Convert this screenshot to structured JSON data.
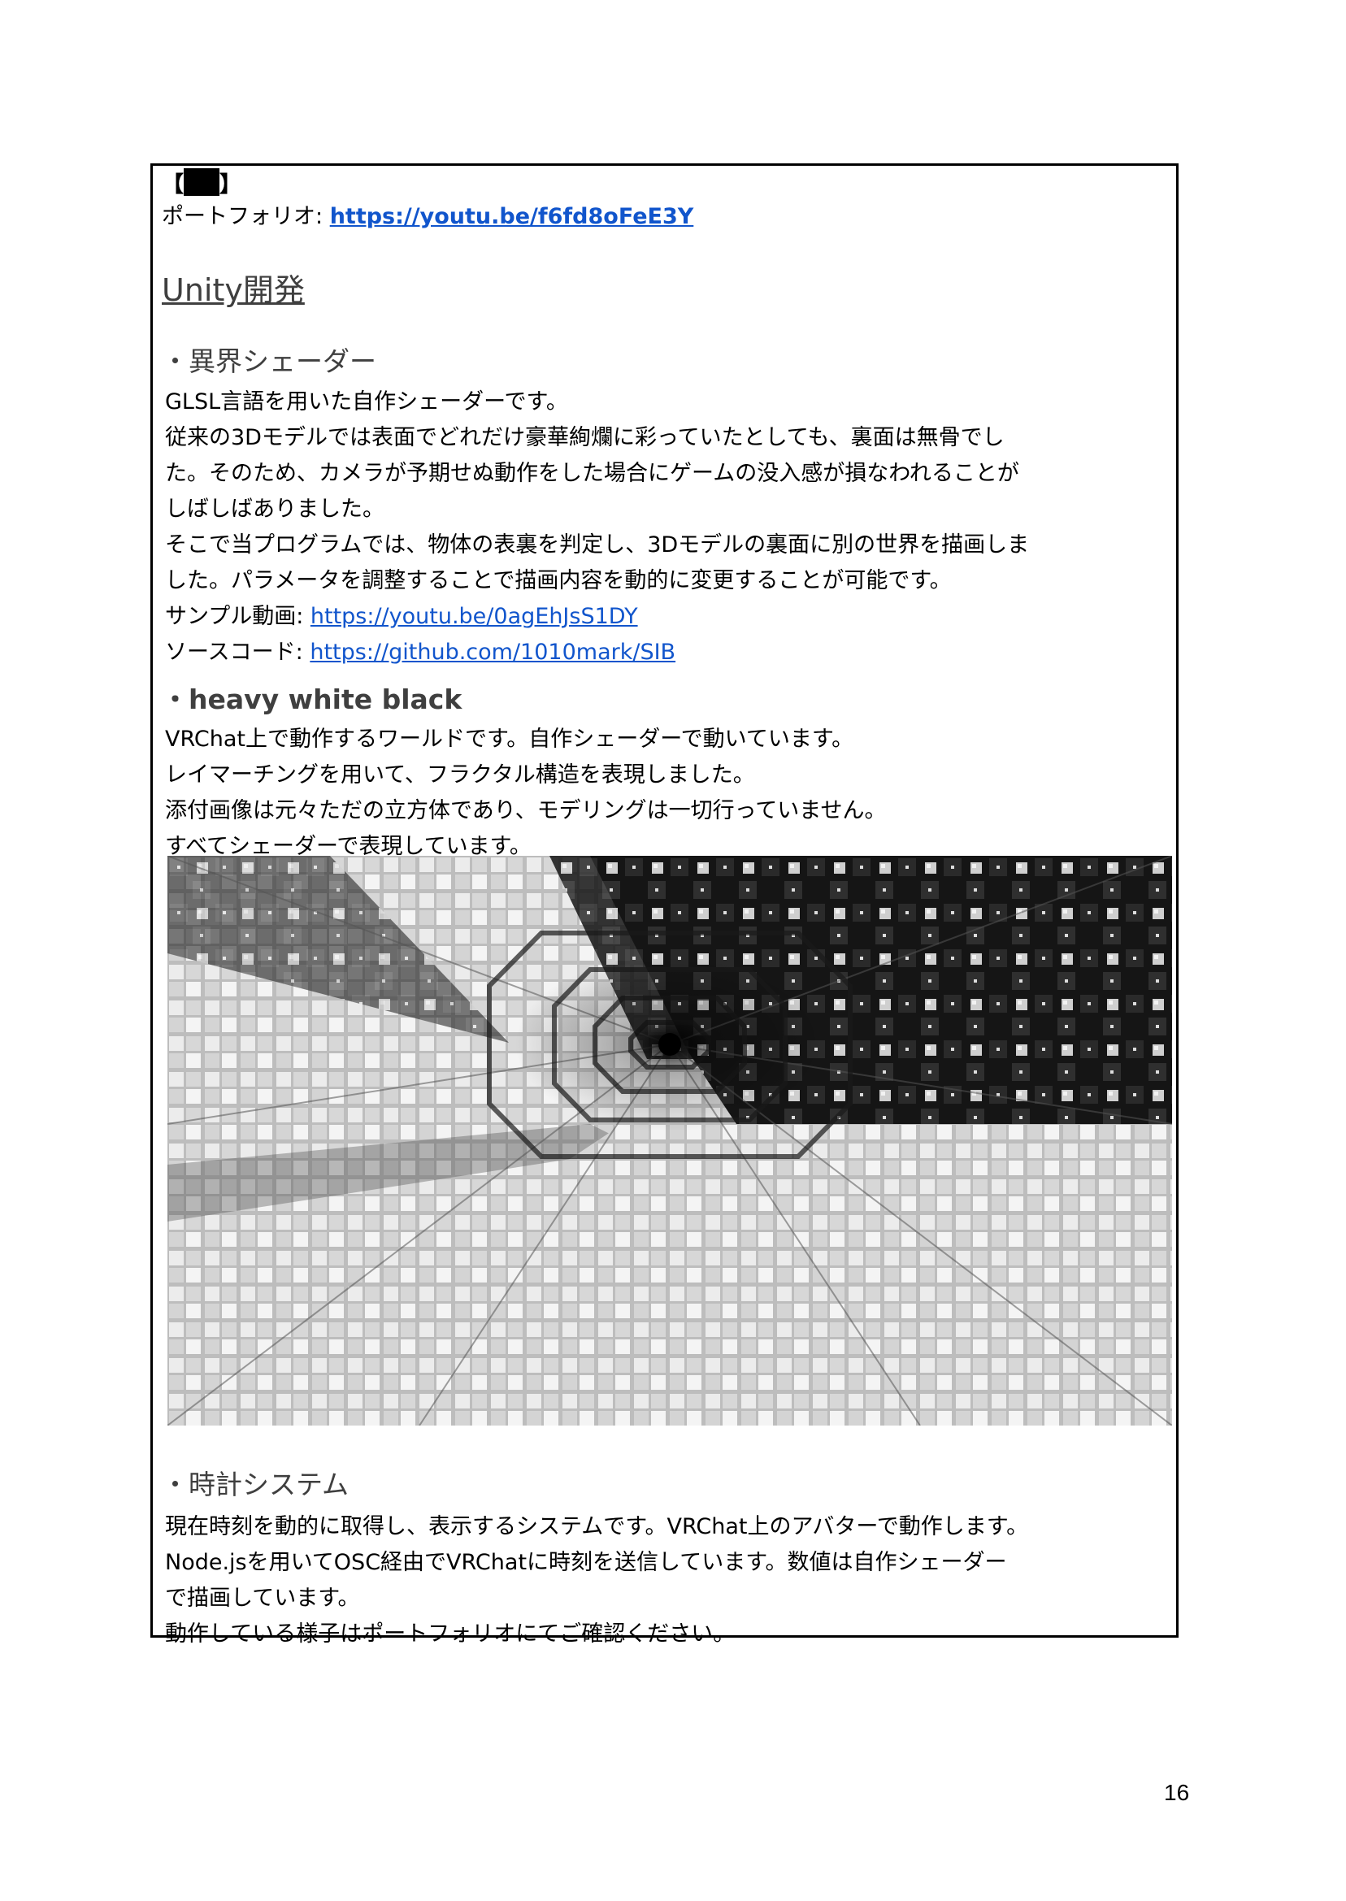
{
  "header": {
    "bracket_open": "【",
    "bracket_close": "】",
    "portfolio_label": "ポートフォリオ: ",
    "portfolio_url": "https://youtu.be/f6fd8oFeE3Y"
  },
  "section_title": "Unity開発",
  "shader": {
    "title": "・異界シェーダー",
    "lines": [
      "GLSL言語を用いた自作シェーダーです。",
      "従来の3Dモデルでは表面でどれだけ豪華絢爛に彩っていたとしても、裏面は無骨でし",
      "た。そのため、カメラが予期せぬ動作をした場合にゲームの没入感が損なわれることが",
      "しばしばありました。",
      "そこで当プログラムでは、物体の表裏を判定し、3Dモデルの裏面に別の世界を描画しま",
      "した。パラメータを調整することで描画内容を動的に変更することが可能です。"
    ],
    "sample_label": "サンプル動画: ",
    "sample_url": "https://youtu.be/0agEhJsS1DY",
    "source_label": "ソースコード: ",
    "source_url": "https://github.com/1010mark/SIB"
  },
  "heavy": {
    "title": "・heavy white black",
    "lines": [
      "VRChat上で動作するワールドです。自作シェーダーで動いています。",
      "レイマーチングを用いて、フラクタル構造を表現しました。",
      "添付画像は元々ただの立方体であり、モデリングは一切行っていません。",
      "すべてシェーダーで表現しています。"
    ]
  },
  "clock": {
    "title": "・時計システム",
    "lines": [
      "現在時刻を動的に取得し、表示するシステムです。VRChat上のアバターで動作します。",
      "Node.jsを用いてOSC経由でVRChatに時刻を送信しています。数値は自作シェーダー",
      "で描画しています。",
      "動作している様子はポートフォリオにてご確認ください。"
    ]
  },
  "page_number": "16"
}
